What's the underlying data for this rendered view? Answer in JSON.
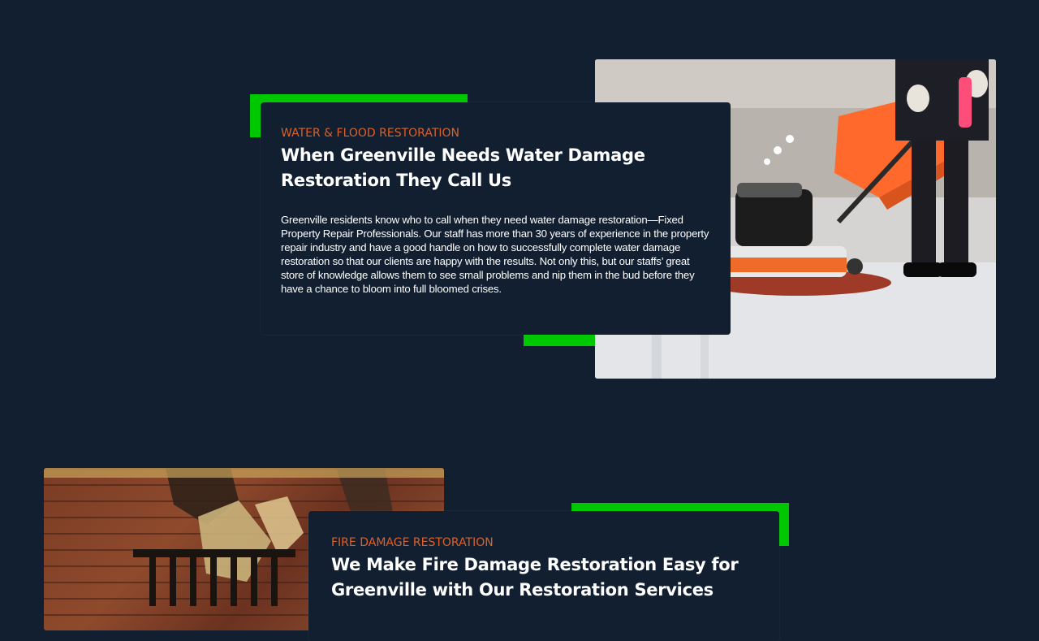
{
  "sections": [
    {
      "eyebrow": "WATER & FLOOD RESTORATION",
      "heading": "When Greenville Needs Water Damage Restoration They Call Us",
      "body": "Greenville residents know who to call when they need water damage restoration—Fixed Property Repair Professionals. Our staff has more than 30 years of experience in the property repair industry and have a good handle on how to successfully complete water damage restoration so that our clients are happy with the results. Not only this, but our staffs’ great store of knowledge allows them to see small problems and nip them in the bud before they have a chance to bloom into full bloomed crises."
    },
    {
      "eyebrow": "FIRE DAMAGE RESTORATION",
      "heading": "We Make Fire Damage Restoration Easy for Greenville with Our Restoration Services"
    }
  ],
  "colors": {
    "background": "#111f30",
    "accent_green": "#00c800",
    "eyebrow_orange": "#d9622b",
    "text": "#ffffff"
  }
}
